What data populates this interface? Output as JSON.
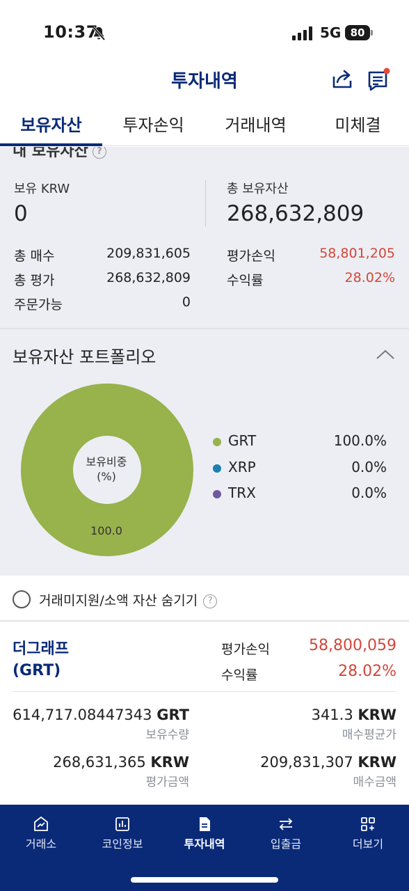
{
  "status": {
    "time": "10:37",
    "network": "5G",
    "battery": "80"
  },
  "header": {
    "title": "투자내역"
  },
  "tabs": [
    {
      "label": "보유자산",
      "active": true
    },
    {
      "label": "투자손익",
      "active": false
    },
    {
      "label": "거래내역",
      "active": false
    },
    {
      "label": "미체결",
      "active": false
    }
  ],
  "summary": {
    "heading": "내 보유자산",
    "krw_label": "보유 KRW",
    "krw_value": "0",
    "total_label": "총 보유자산",
    "total_value": "268,632,809",
    "left_rows": [
      {
        "label": "총 매수",
        "value": "209,831,605"
      },
      {
        "label": "총 평가",
        "value": "268,632,809"
      },
      {
        "label": "주문가능",
        "value": "0"
      }
    ],
    "right_rows": [
      {
        "label": "평가손익",
        "value": "58,801,205"
      },
      {
        "label": "수익률",
        "value": "28.02%"
      }
    ]
  },
  "portfolio": {
    "title": "보유자산 포트폴리오",
    "center_label_1": "보유비중",
    "center_label_2": "(%)",
    "slice_label": "100.0",
    "colors": {
      "GRT": "#98b24c",
      "XRP": "#1c7fb0",
      "TRX": "#6e58a0"
    },
    "legend": [
      {
        "name": "GRT",
        "pct": "100.0%"
      },
      {
        "name": "XRP",
        "pct": "0.0%"
      },
      {
        "name": "TRX",
        "pct": "0.0%"
      }
    ]
  },
  "hide_small": {
    "label": "거래미지원/소액 자산 숨기기"
  },
  "asset": {
    "name_line1": "더그래프",
    "name_line2": "(GRT)",
    "pnl_label": "평가손익",
    "pnl_value": "58,800,059",
    "rate_label": "수익률",
    "rate_value": "28.02%",
    "quantity_value": "614,717.08447343",
    "quantity_unit": "GRT",
    "quantity_label": "보유수량",
    "avg_price_value": "341.3",
    "avg_price_unit": "KRW",
    "avg_price_label": "매수평균가",
    "eval_amount_value": "268,631,365",
    "eval_amount_unit": "KRW",
    "eval_amount_label": "평가금액",
    "buy_amount_value": "209,831,307",
    "buy_amount_unit": "KRW",
    "buy_amount_label": "매수금액"
  },
  "bottom_nav": [
    {
      "label": "거래소",
      "icon": "exchange-icon",
      "active": false
    },
    {
      "label": "코인정보",
      "icon": "chart-icon",
      "active": false
    },
    {
      "label": "투자내역",
      "icon": "document-icon",
      "active": true
    },
    {
      "label": "입출금",
      "icon": "transfer-icon",
      "active": false
    },
    {
      "label": "더보기",
      "icon": "more-grid-icon",
      "active": false
    }
  ],
  "colors": {
    "brand": "#0a2a78",
    "loss_profit_red": "#d2463a"
  }
}
